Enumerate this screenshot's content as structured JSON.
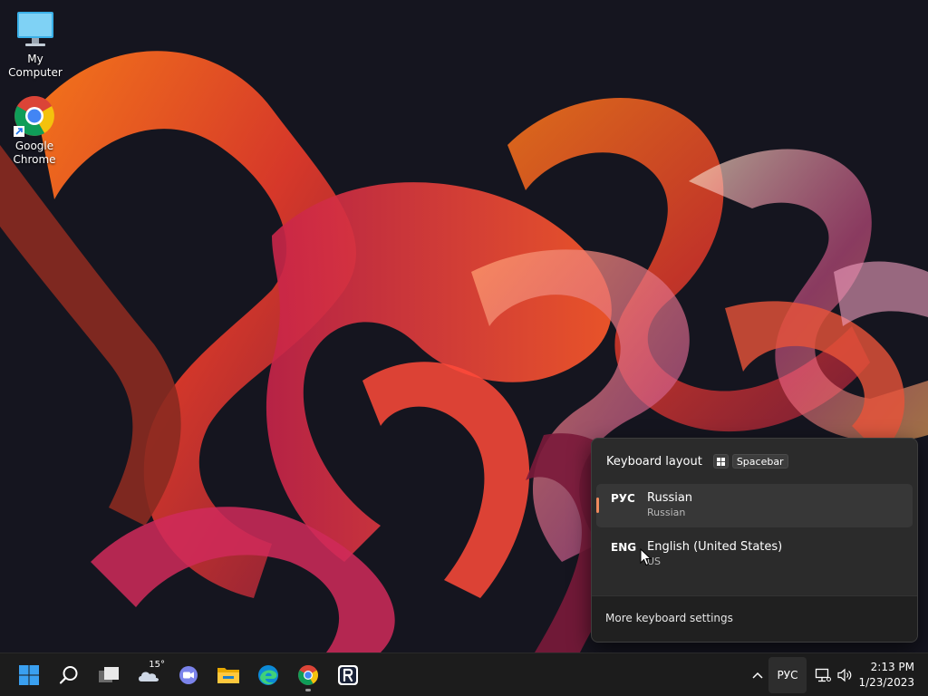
{
  "desktop": {
    "icons": [
      {
        "label": "My Computer"
      },
      {
        "label": "Google Chrome"
      }
    ]
  },
  "keyboard_flyout": {
    "title": "Keyboard layout",
    "shortcut_space": "Spacebar",
    "layouts": [
      {
        "code": "РУС",
        "name": "Russian",
        "sub": "Russian",
        "selected": true
      },
      {
        "code": "ENG",
        "name": "English (United States)",
        "sub": "US",
        "selected": false
      }
    ],
    "settings_link": "More keyboard settings"
  },
  "taskbar": {
    "weather_temp": "15°",
    "apps": [
      "start-icon",
      "search-icon",
      "task-view-icon",
      "weather-icon",
      "chat-icon",
      "file-explorer-icon",
      "edge-icon",
      "chrome-icon",
      "r-app-icon"
    ],
    "language": "РУС",
    "clock": {
      "time": "2:13 PM",
      "date": "1/23/2023"
    }
  },
  "colors": {
    "taskbar": "#1c1c1c",
    "flyout": "#2b2b2b",
    "accent": "#f08a5d",
    "start_blue": "#3aa0f0"
  }
}
